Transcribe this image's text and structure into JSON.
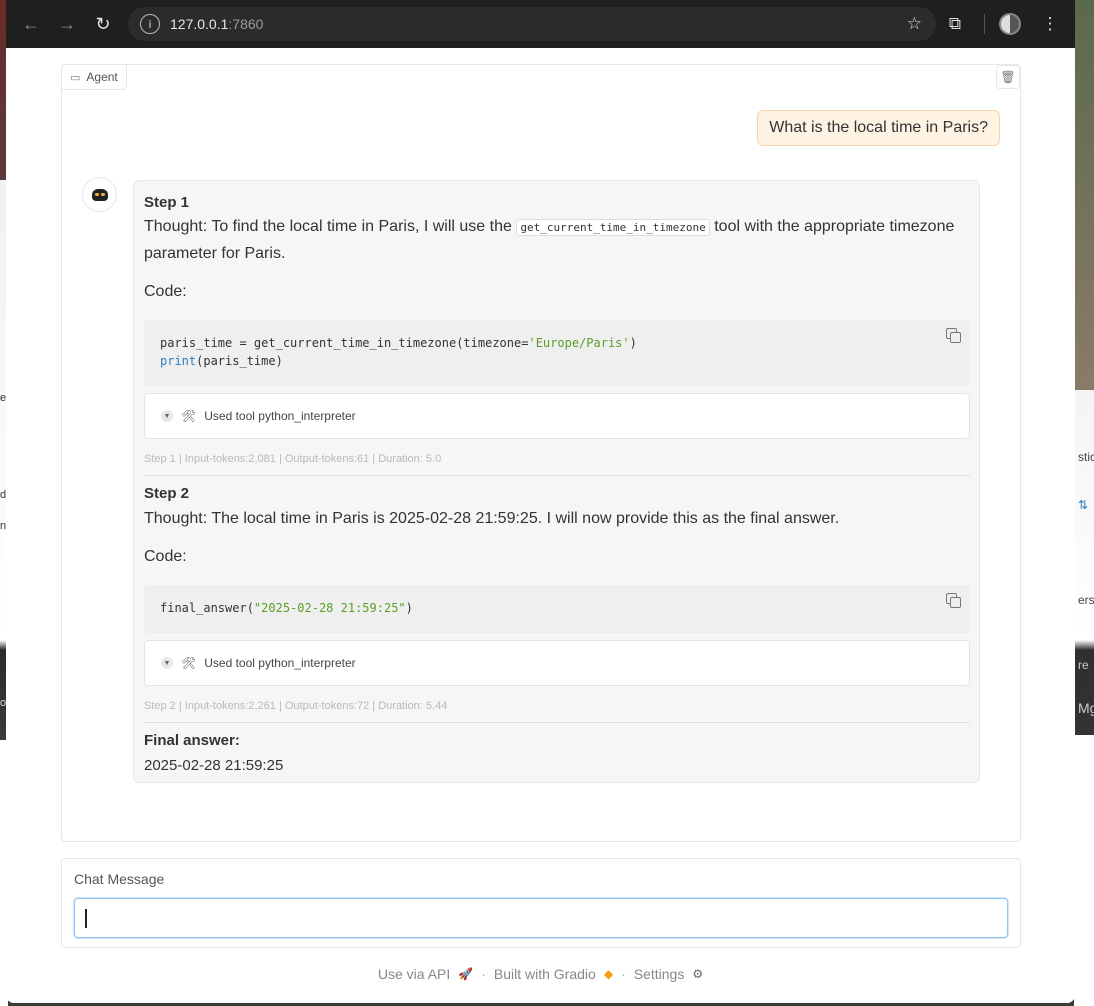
{
  "browser": {
    "url_host": "127.0.0.1",
    "url_port": ":7860"
  },
  "background": {
    "right_fragments": [
      "stic_",
      "⇅",
      "ersi",
      "re",
      "Mg"
    ],
    "left_fragments": [
      "e",
      "d",
      "n",
      "o"
    ]
  },
  "chatbot": {
    "label": "Agent",
    "user_message": "What is the local time in Paris?",
    "steps": [
      {
        "title": "Step 1",
        "thought_prefix": "Thought: To find the local time in Paris, I will use the ",
        "thought_code": "get_current_time_in_timezone",
        "thought_suffix": " tool with the appropriate timezone parameter for Paris.",
        "code_label": "Code:",
        "code_line1_a": "paris_time = get_current_time_in_timezone(timezone=",
        "code_line1_str": "'Europe/Paris'",
        "code_line1_b": ")",
        "code_line2_kw": "print",
        "code_line2_b": "(paris_time)",
        "tool_label": "Used tool python_interpreter",
        "meta": "Step 1 | Input-tokens:2,081 | Output-tokens:61 | Duration: 5.0"
      },
      {
        "title": "Step 2",
        "thought": "Thought: The local time in Paris is 2025-02-28 21:59:25. I will now provide this as the final answer.",
        "code_label": "Code:",
        "code_a": "final_answer(",
        "code_str": "\"2025-02-28 21:59:25\"",
        "code_b": ")",
        "tool_label": "Used tool python_interpreter",
        "meta": "Step 2 | Input-tokens:2,261 | Output-tokens:72 | Duration: 5.44"
      }
    ],
    "final_answer_title": "Final answer:",
    "final_answer_value": "2025-02-28 21:59:25"
  },
  "input": {
    "label": "Chat Message",
    "value": ""
  },
  "footer": {
    "api": "Use via API",
    "built": "Built with Gradio",
    "settings": "Settings",
    "separator": "·"
  }
}
